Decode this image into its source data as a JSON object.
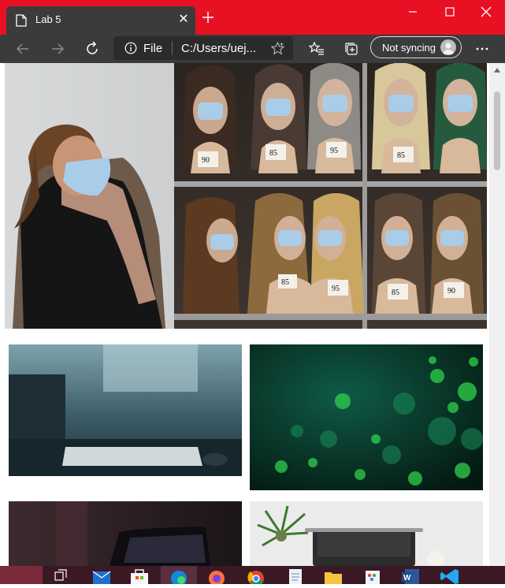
{
  "tab": {
    "title": "Lab 5",
    "close_glyph": "✕"
  },
  "address_bar": {
    "scheme_label": "File",
    "url": "C:/Users/uej..."
  },
  "sync": {
    "label": "Not syncing"
  },
  "colors": {
    "titlebar": "#e81123",
    "toolbar": "#3b3b3b",
    "taskbar": "#3a1824"
  },
  "images": [
    {
      "name": "masked-woman-wig-shop-photo",
      "prices": [
        "90",
        "85",
        "95",
        "85",
        "85",
        "95",
        "85",
        "90"
      ]
    },
    {
      "name": "keyboard-desk-photo"
    },
    {
      "name": "green-bokeh-photo"
    },
    {
      "name": "laptop-dark-photo"
    },
    {
      "name": "laptop-plant-desk-photo"
    }
  ],
  "icons": {
    "tab": "page-icon",
    "new_tab": "plus-icon",
    "window": [
      "minimize-icon",
      "maximize-icon",
      "close-icon"
    ],
    "toolbar": [
      "back-arrow-icon",
      "forward-arrow-icon",
      "refresh-icon",
      "info-icon",
      "star-icon",
      "favorites-icon",
      "collections-icon",
      "more-icon"
    ],
    "taskbar": [
      "task-view-icon",
      "mail-icon",
      "store-icon",
      "edge-icon",
      "firefox-icon",
      "chrome-icon",
      "notepad-icon",
      "file-explorer-icon",
      "paint-icon",
      "word-icon",
      "vscode-icon"
    ]
  }
}
